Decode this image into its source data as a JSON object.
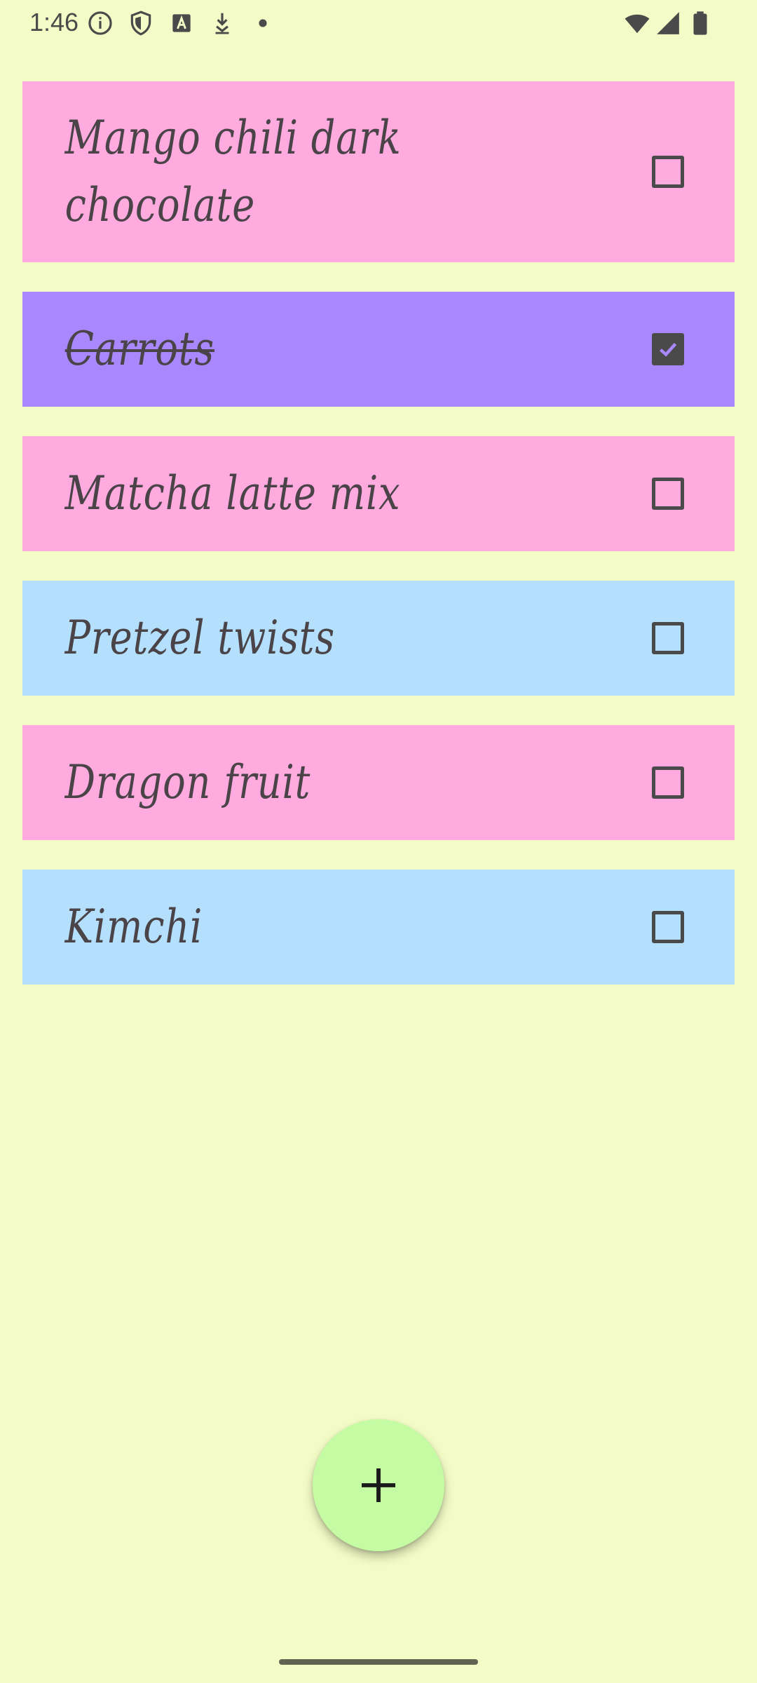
{
  "status_bar": {
    "time": "1:46",
    "left_icons": [
      "info-icon",
      "shield-icon",
      "font-icon",
      "download-icon",
      "dot-icon"
    ],
    "right_icons": [
      "wifi-icon",
      "signal-icon",
      "battery-icon"
    ]
  },
  "items": [
    {
      "label": "Mango chili dark chocolate",
      "checked": false,
      "color": "#ffabe0"
    },
    {
      "label": "Carrots",
      "checked": true,
      "color": "#a888fc"
    },
    {
      "label": "Matcha latte mix",
      "checked": false,
      "color": "#ffabe0"
    },
    {
      "label": "Pretzel twists",
      "checked": false,
      "color": "#b4e0fe"
    },
    {
      "label": "Dragon fruit",
      "checked": false,
      "color": "#ffabe0"
    },
    {
      "label": "Kimchi",
      "checked": false,
      "color": "#b4e0fe"
    }
  ],
  "fab": {
    "icon": "plus-icon",
    "color": "#c5fba2"
  },
  "colors": {
    "background": "#f3fcc6",
    "text": "#4a4348"
  }
}
